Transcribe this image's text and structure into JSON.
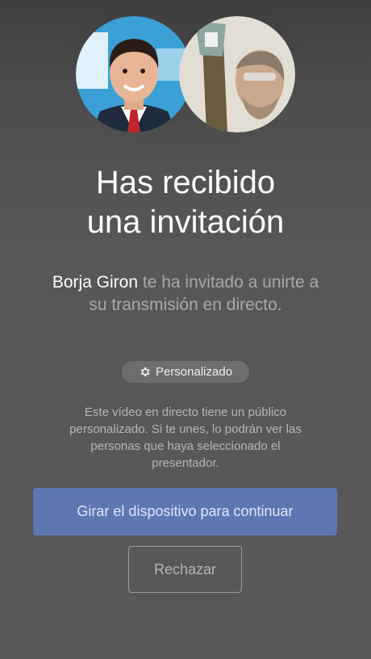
{
  "invitation": {
    "title_line1": "Has recibido",
    "title_line2": "una invitación",
    "host_name": "Borja Giron",
    "message": " te ha invitado a unirte a su transmisión en directo.",
    "audience_badge": "Personalizado",
    "audience_note": "Este vídeo en directo tiene un público personalizado. Si te unes, lo podrán ver las personas que haya seleccionado el presentador."
  },
  "actions": {
    "primary_label": "Girar el dispositivo para continuar",
    "secondary_label": "Rechazar"
  },
  "avatars": [
    {
      "icon": "host-avatar"
    },
    {
      "icon": "viewer-avatar"
    }
  ],
  "icons": {
    "badge_icon": "gear-icon"
  },
  "colors": {
    "background": "#585858",
    "primary_button": "#5e77b3",
    "title_text": "#ffffff",
    "muted_text": "#a9a9a9"
  }
}
